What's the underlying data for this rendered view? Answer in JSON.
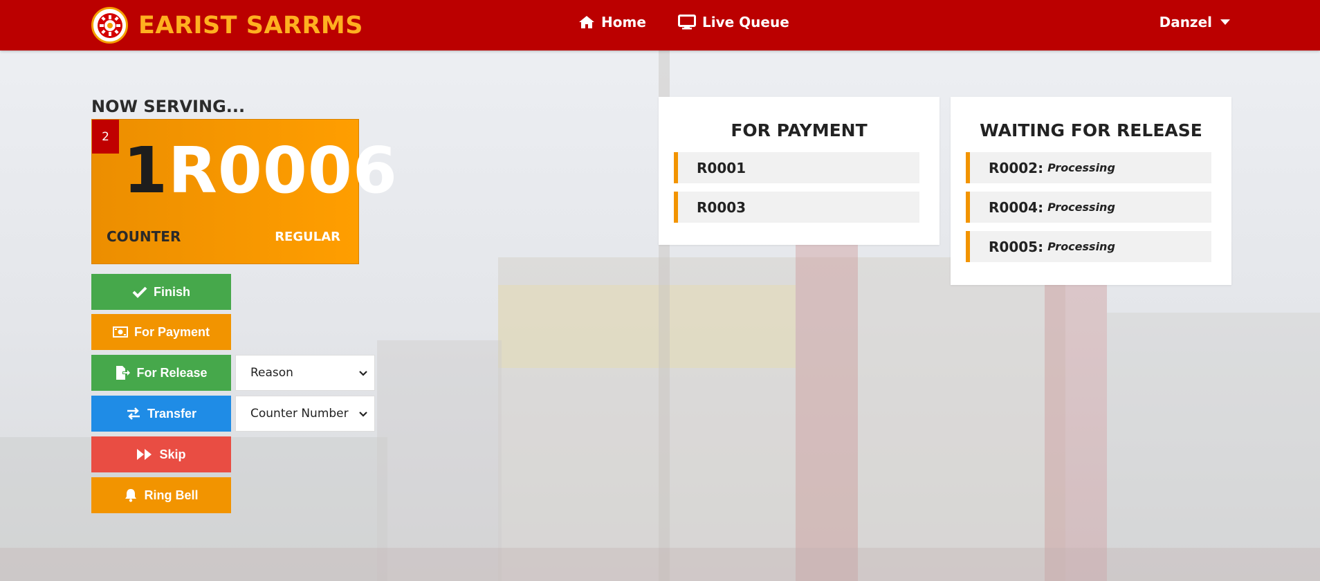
{
  "navbar": {
    "brand": "EARIST SARRMS",
    "links": [
      {
        "label": "Home",
        "icon": "home-icon"
      },
      {
        "label": "Live Queue",
        "icon": "monitor-icon"
      }
    ],
    "user": "Danzel"
  },
  "serving": {
    "heading": "NOW SERVING...",
    "badge": "2",
    "counter_number": "1",
    "code": "R0006",
    "counter_label": "COUNTER",
    "type": "REGULAR"
  },
  "actions": {
    "finish": "Finish",
    "for_payment": "For Payment",
    "for_release": "For Release",
    "transfer": "Transfer",
    "skip": "Skip",
    "ring_bell": "Ring Bell"
  },
  "selects": {
    "reason": "Reason",
    "counter_number": "Counter Number"
  },
  "for_payment_panel": {
    "title": "FOR PAYMENT",
    "items": [
      "R0001",
      "R0003"
    ]
  },
  "release_panel": {
    "title": "WAITING FOR RELEASE",
    "items": [
      {
        "code": "R0002:",
        "status": "Processing"
      },
      {
        "code": "R0004:",
        "status": "Processing"
      },
      {
        "code": "R0005:",
        "status": "Processing"
      }
    ]
  },
  "colors": {
    "navbar": "#bb0000",
    "brand": "#ffb020",
    "accent_orange": "#f29400",
    "green": "#46a84b",
    "blue": "#1f8ce6",
    "red": "#e94d43"
  }
}
